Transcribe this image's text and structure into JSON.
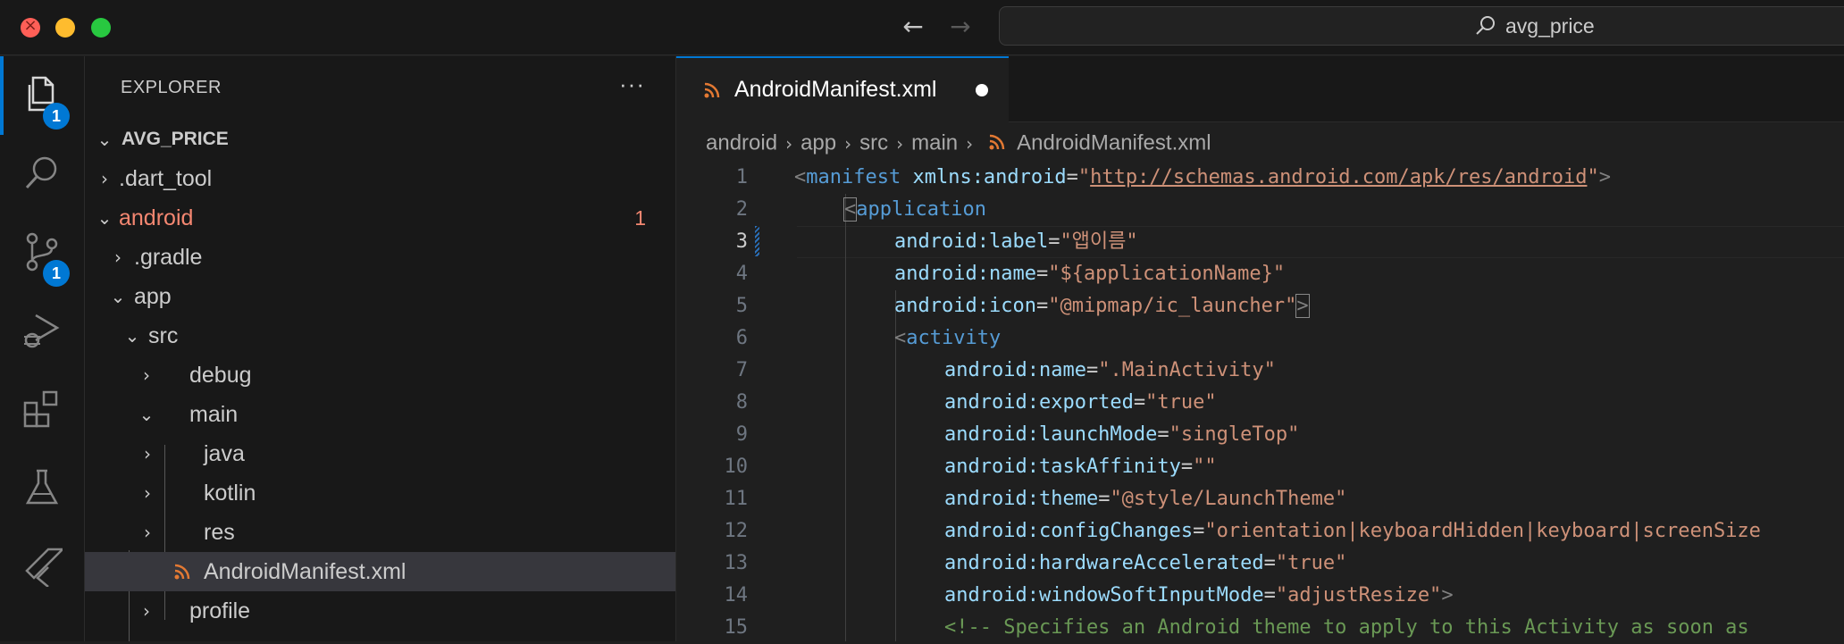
{
  "titlebar": {
    "search_text": "avg_price",
    "back_icon": "arrow-left-icon",
    "forward_icon": "arrow-right-icon"
  },
  "activity_bar": {
    "items": [
      {
        "name": "explorer",
        "icon": "files-icon",
        "badge": "1",
        "active": true
      },
      {
        "name": "search",
        "icon": "search-icon"
      },
      {
        "name": "source-control",
        "icon": "source-control-icon",
        "badge": "1"
      },
      {
        "name": "run-debug",
        "icon": "run-debug-icon"
      },
      {
        "name": "extensions",
        "icon": "extensions-icon"
      },
      {
        "name": "testing",
        "icon": "flask-icon"
      },
      {
        "name": "flutter",
        "icon": "flutter-icon"
      }
    ]
  },
  "explorer": {
    "title": "EXPLORER",
    "more": "···",
    "project": "AVG_PRICE",
    "items": [
      {
        "label": ".dart_tool",
        "expanded": false
      },
      {
        "label": "android",
        "expanded": true,
        "error_count": "1"
      },
      {
        "label": ".gradle",
        "expanded": false
      },
      {
        "label": "app",
        "expanded": true
      },
      {
        "label": "src",
        "expanded": true
      },
      {
        "label": "debug",
        "expanded": false
      },
      {
        "label": "main",
        "expanded": true
      },
      {
        "label": "java",
        "expanded": false
      },
      {
        "label": "kotlin",
        "expanded": false
      },
      {
        "label": "res",
        "expanded": false
      },
      {
        "label": "AndroidManifest.xml",
        "selected": true
      },
      {
        "label": "profile",
        "expanded": false
      }
    ]
  },
  "editor": {
    "tab_label": "AndroidManifest.xml",
    "breadcrumb": [
      "android",
      "app",
      "src",
      "main",
      "AndroidManifest.xml"
    ],
    "line_numbers": [
      "1",
      "2",
      "3",
      "4",
      "5",
      "6",
      "7",
      "8",
      "9",
      "10",
      "11",
      "12",
      "13",
      "14",
      "15"
    ],
    "active_line": "3",
    "code": {
      "l1": {
        "open": "<",
        "tag": "manifest",
        "attr": " xmlns:android",
        "eq": "=",
        "q1": "\"",
        "url": "http://schemas.android.com/apk/res/android",
        "q2": "\"",
        "close": ">"
      },
      "l2": {
        "open": "<",
        "tag": "application"
      },
      "l3": {
        "attr": "android:label",
        "eq": "=",
        "val": "\"앱이름\""
      },
      "l4": {
        "attr": "android:name",
        "eq": "=",
        "val": "\"${applicationName}\""
      },
      "l5": {
        "attr": "android:icon",
        "eq": "=",
        "val": "\"@mipmap/ic_launcher\"",
        "close": ">"
      },
      "l6": {
        "open": "<",
        "tag": "activity"
      },
      "l7": {
        "attr": "android:name",
        "eq": "=",
        "val": "\".MainActivity\""
      },
      "l8": {
        "attr": "android:exported",
        "eq": "=",
        "val": "\"true\""
      },
      "l9": {
        "attr": "android:launchMode",
        "eq": "=",
        "val": "\"singleTop\""
      },
      "l10": {
        "attr": "android:taskAffinity",
        "eq": "=",
        "val": "\"\""
      },
      "l11": {
        "attr": "android:theme",
        "eq": "=",
        "val": "\"@style/LaunchTheme\""
      },
      "l12": {
        "attr": "android:configChanges",
        "eq": "=",
        "val": "\"orientation|keyboardHidden|keyboard|screenSize"
      },
      "l13": {
        "attr": "android:hardwareAccelerated",
        "eq": "=",
        "val": "\"true\""
      },
      "l14": {
        "attr": "android:windowSoftInputMode",
        "eq": "=",
        "val": "\"adjustResize\"",
        "close": ">"
      },
      "l15": {
        "comment": "<!-- Specifies an Android theme to apply to this Activity as soon as"
      }
    }
  },
  "colors": {
    "accent": "#0078d4",
    "error": "#f48771",
    "xml_tag": "#569cd6",
    "xml_attr": "#9cdcfe",
    "xml_string": "#ce9178",
    "comment": "#6a9955",
    "rss_icon": "#e37933"
  }
}
